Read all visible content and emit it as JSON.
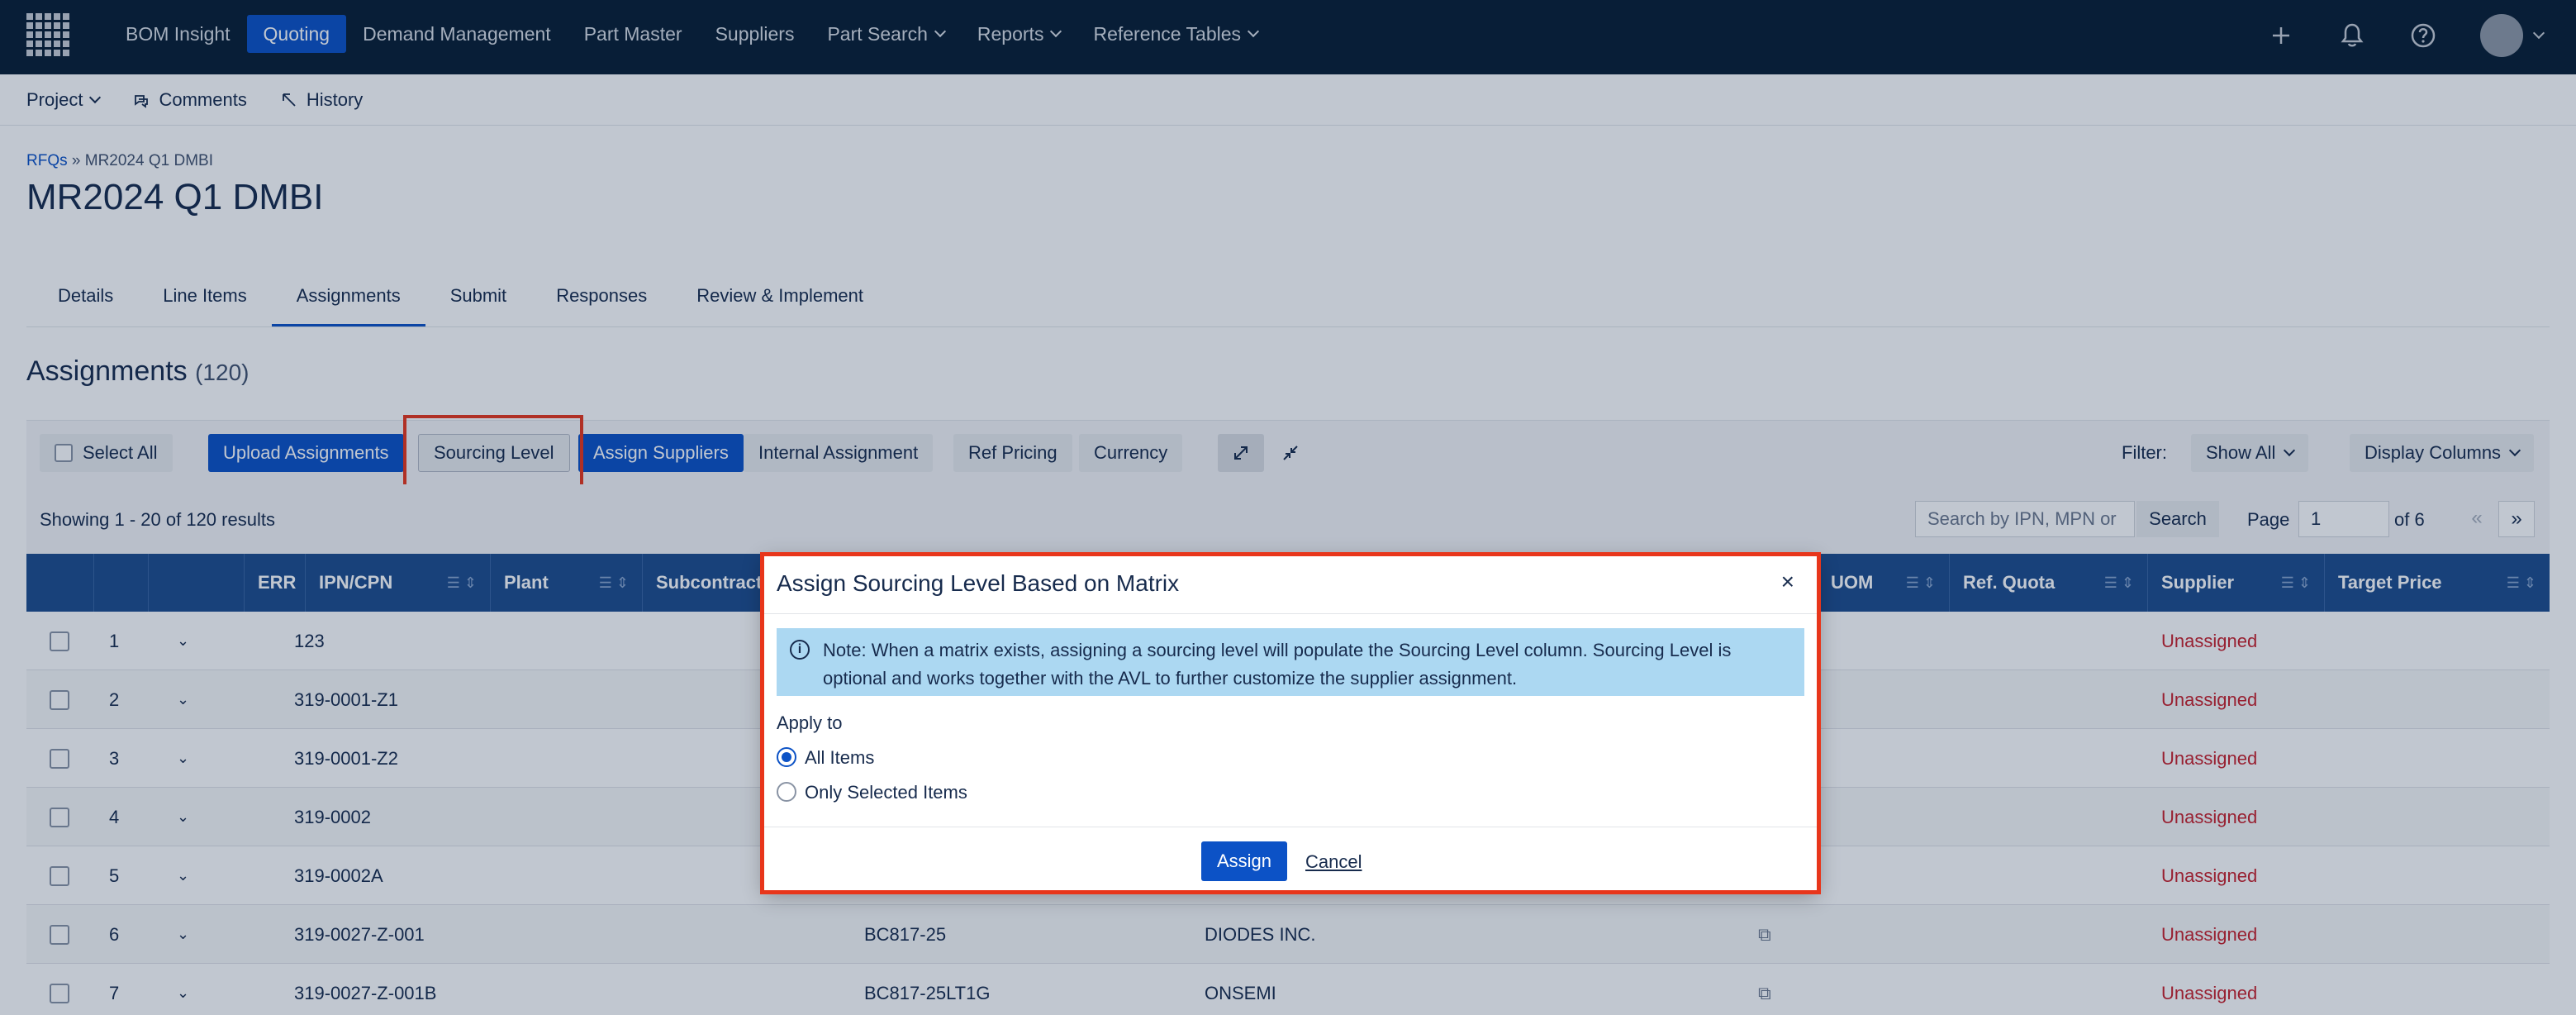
{
  "topnav": {
    "items": [
      {
        "label": "BOM Insight"
      },
      {
        "label": "Quoting"
      },
      {
        "label": "Demand Management"
      },
      {
        "label": "Part Master"
      },
      {
        "label": "Suppliers"
      },
      {
        "label": "Part Search"
      },
      {
        "label": "Reports"
      },
      {
        "label": "Reference Tables"
      }
    ],
    "active": "Quoting",
    "icons": [
      "plus-icon",
      "bell-icon",
      "help-icon",
      "avatar"
    ]
  },
  "subnav": {
    "project": "Project",
    "comments": "Comments",
    "history": "History"
  },
  "breadcrumb": {
    "root": "RFQs",
    "sep": "»",
    "current": "MR2024 Q1 DMBI"
  },
  "page_title": "MR2024 Q1 DMBI",
  "tabs": [
    "Details",
    "Line Items",
    "Assignments",
    "Submit",
    "Responses",
    "Review & Implement"
  ],
  "active_tab": "Assignments",
  "section": {
    "title": "Assignments",
    "count": "(120)"
  },
  "toolbar": {
    "select_all": "Select All",
    "upload_assignments": "Upload Assignments",
    "sourcing_level": "Sourcing Level",
    "assign_suppliers": "Assign Suppliers",
    "internal_assignment": "Internal Assignment",
    "ref_pricing": "Ref Pricing",
    "currency": "Currency",
    "filter_label": "Filter:",
    "filter_value": "Show All",
    "display_columns": "Display Columns"
  },
  "results": {
    "showing": "Showing 1 - 20 of 120 results",
    "search_placeholder": "Search by IPN, MPN or",
    "search_button": "Search",
    "page_label": "Page",
    "page_value": "1",
    "page_of": "of 6",
    "prev": "«",
    "next": "»"
  },
  "table": {
    "columns": [
      "ERR",
      "IPN/CPN",
      "Plant",
      "Subcontractor",
      "UOM",
      "Ref. Quota",
      "Supplier",
      "Target Price"
    ],
    "rows": [
      {
        "num": "1",
        "ipn": "123",
        "mpn": "",
        "mfr": "",
        "supplier": "Unassigned",
        "copy": false
      },
      {
        "num": "2",
        "ipn": "319-0001-Z1",
        "mpn": "",
        "mfr": "",
        "supplier": "Unassigned",
        "copy": false
      },
      {
        "num": "3",
        "ipn": "319-0001-Z2",
        "mpn": "",
        "mfr": "",
        "supplier": "Unassigned",
        "copy": false
      },
      {
        "num": "4",
        "ipn": "319-0002",
        "mpn": "",
        "mfr": "",
        "supplier": "Unassigned",
        "copy": false
      },
      {
        "num": "5",
        "ipn": "319-0002A",
        "mpn": "",
        "mfr": "",
        "supplier": "Unassigned",
        "copy": false
      },
      {
        "num": "6",
        "ipn": "319-0027-Z-001",
        "mpn": "BC817-25",
        "mfr": "DIODES INC.",
        "supplier": "Unassigned",
        "copy": true
      },
      {
        "num": "7",
        "ipn": "319-0027-Z-001B",
        "mpn": "BC817-25LT1G",
        "mfr": "ONSEMI",
        "supplier": "Unassigned",
        "copy": true
      }
    ]
  },
  "modal": {
    "title": "Assign Sourcing Level Based on Matrix",
    "close": "×",
    "note": "Note: When a matrix exists, assigning a sourcing level will populate the Sourcing Level column. Sourcing Level is optional and works together with the AVL to further customize the supplier assignment.",
    "apply_to": "Apply to",
    "option_all": "All Items",
    "option_selected": "Only Selected Items",
    "selected_option": "All Items",
    "assign": "Assign",
    "cancel": "Cancel"
  },
  "colors": {
    "nav_bg": "#091e33",
    "primary": "#0c52c6",
    "table_header": "#1e4c8c",
    "unassigned": "#c8202b",
    "highlight": "#e8361b",
    "note_bg": "#acd8f2"
  }
}
